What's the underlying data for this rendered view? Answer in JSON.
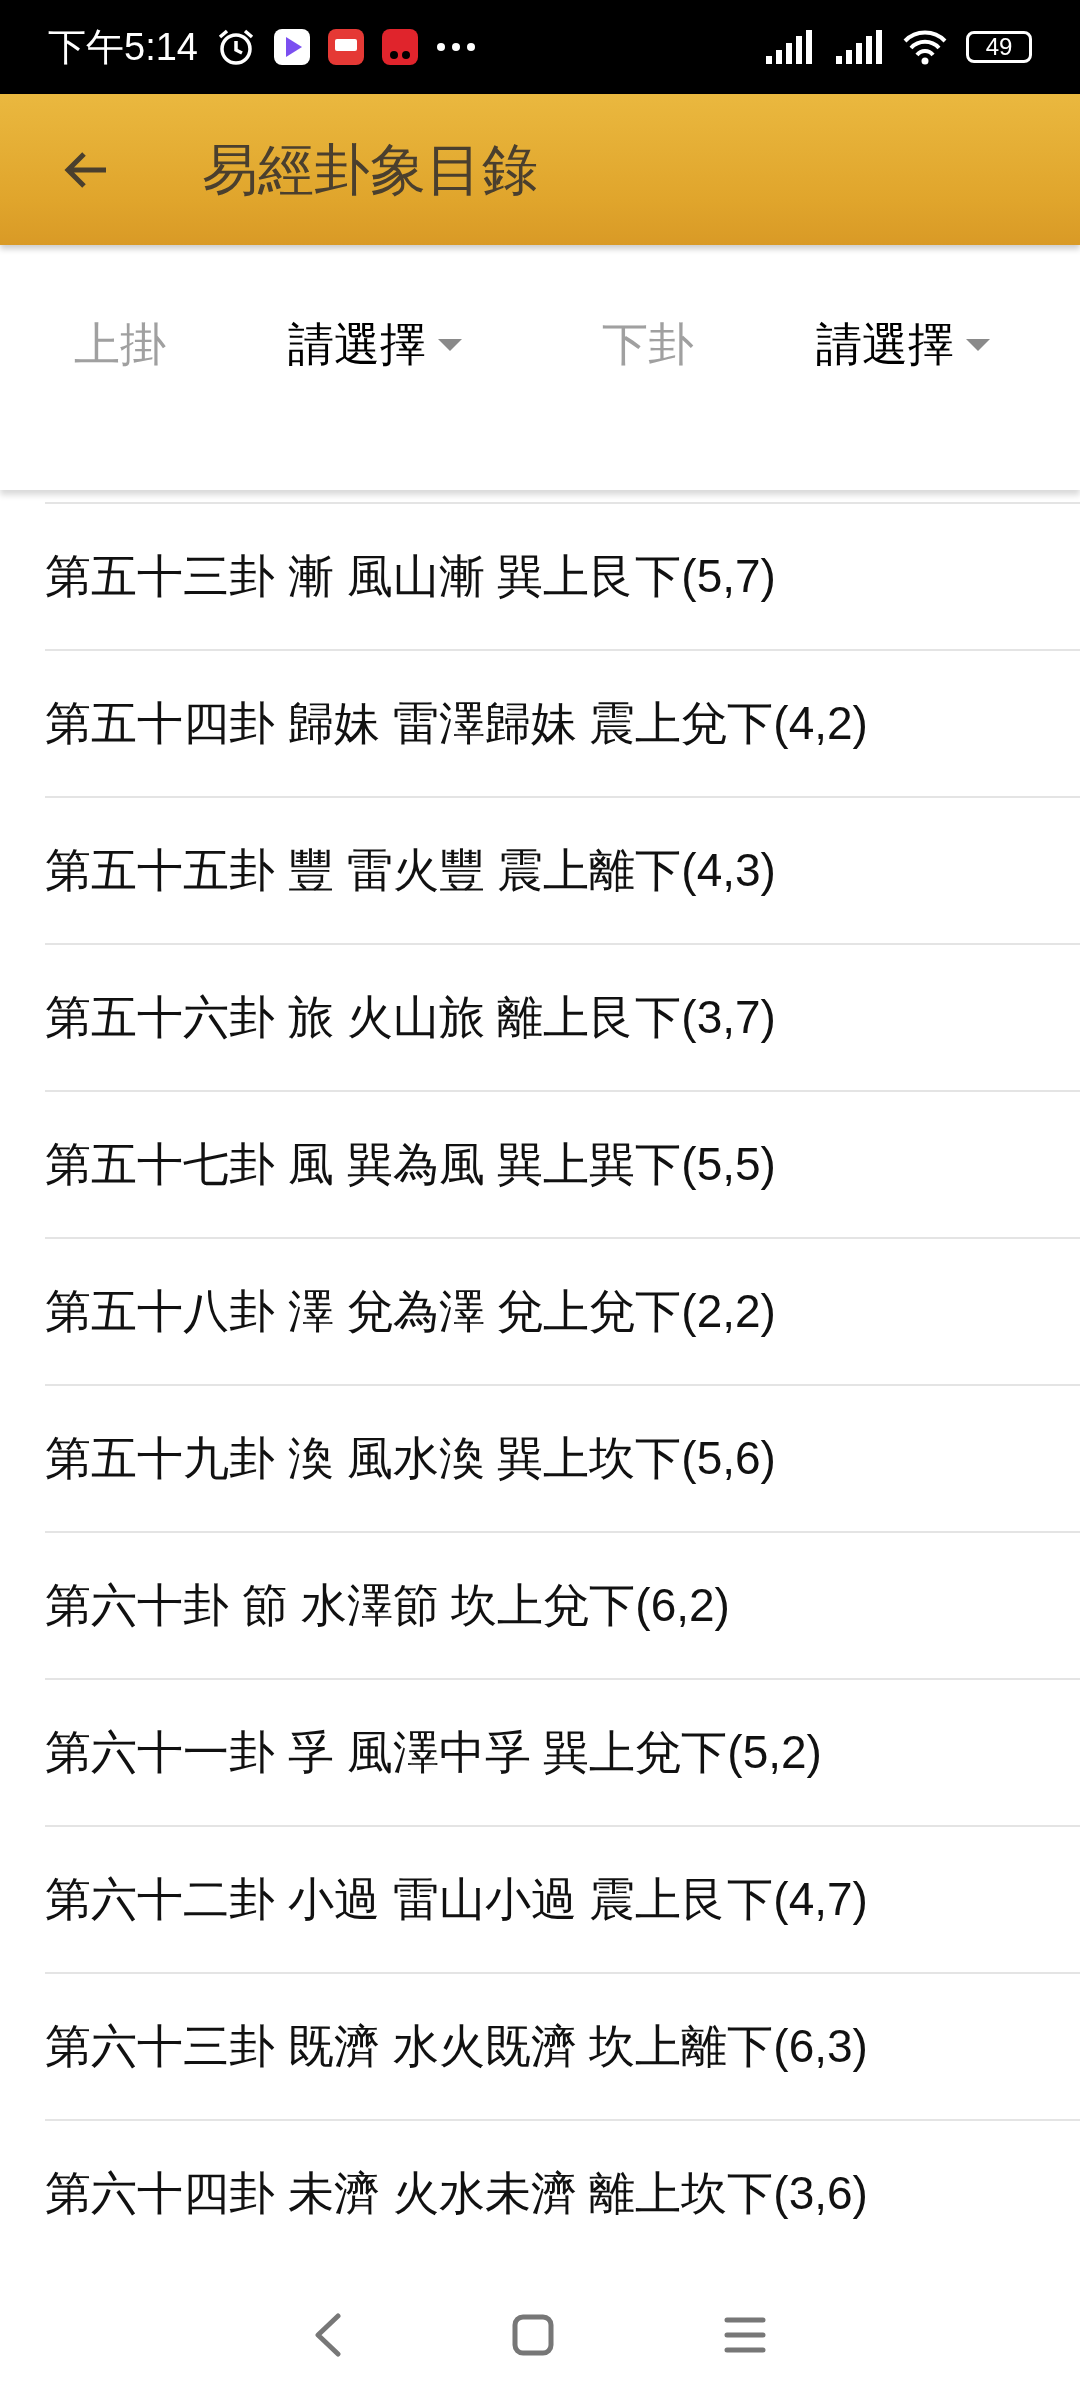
{
  "status_bar": {
    "time": "下午5:14",
    "battery": "49"
  },
  "app_bar": {
    "title": "易經卦象目錄"
  },
  "filters": [
    {
      "label": "上掛",
      "value": "請選擇"
    },
    {
      "label": "下卦",
      "value": "請選擇"
    }
  ],
  "list": [
    {
      "text": "第五十三卦 漸 風山漸 巽上艮下(5,7)"
    },
    {
      "text": "第五十四卦 歸妹 雷澤歸妹 震上兌下(4,2)"
    },
    {
      "text": "第五十五卦 豐 雷火豐 震上離下(4,3)"
    },
    {
      "text": "第五十六卦 旅 火山旅 離上艮下(3,7)"
    },
    {
      "text": "第五十七卦 風 巽為風 巽上巽下(5,5)"
    },
    {
      "text": "第五十八卦 澤 兌為澤 兌上兌下(2,2)"
    },
    {
      "text": "第五十九卦 渙 風水渙 巽上坎下(5,6)"
    },
    {
      "text": "第六十卦 節 水澤節 坎上兌下(6,2)"
    },
    {
      "text": "第六十一卦 孚 風澤中孚 巽上兌下(5,2)"
    },
    {
      "text": "第六十二卦 小過 雷山小過 震上艮下(4,7)"
    },
    {
      "text": "第六十三卦 既濟 水火既濟 坎上離下(6,3)"
    },
    {
      "text": "第六十四卦 未濟 火水未濟 離上坎下(3,6)"
    }
  ]
}
